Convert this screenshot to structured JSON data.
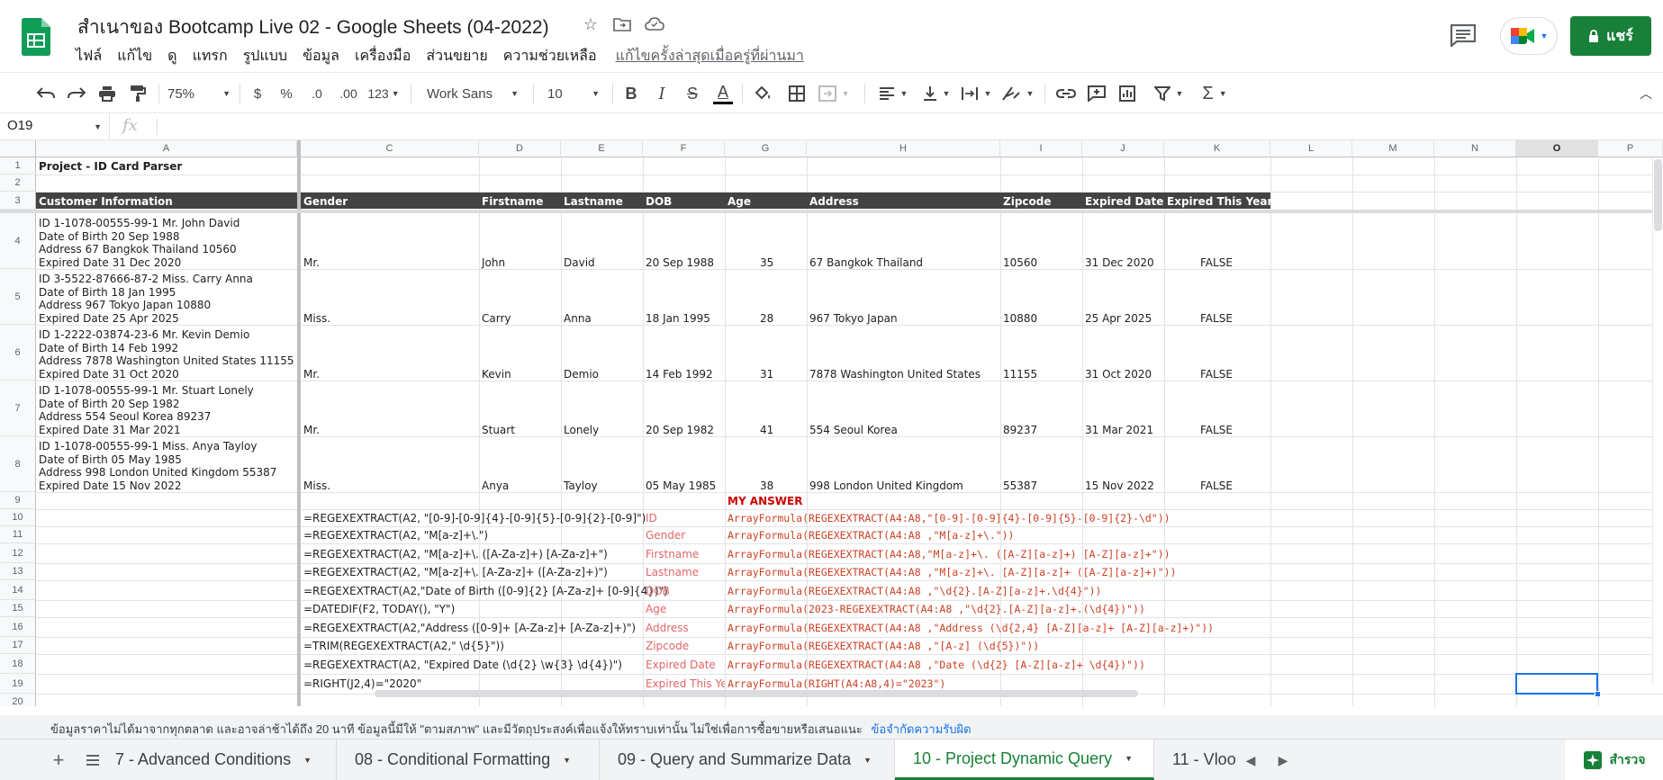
{
  "app": {
    "title": "สำเนาของ Bootcamp Live 02 - Google Sheets (04-2022)",
    "menu": [
      "ไฟล์",
      "แก้ไข",
      "ดู",
      "แทรก",
      "รูปแบบ",
      "ข้อมูล",
      "เครื่องมือ",
      "ส่วนขยาย",
      "ความช่วยเหลือ"
    ],
    "last_edit": "แก้ไขครั้งล่าสุดเมื่อครู่ที่ผ่านมา",
    "share_label": "แชร์",
    "colors": {
      "brand_green": "#188038",
      "header_band": "#434343",
      "formula_red": "#e06666",
      "selection_blue": "#1a73e8"
    }
  },
  "toolbar": {
    "zoom": "75%",
    "currency": "$",
    "percent": "%",
    "decrease_decimal": ".0",
    "increase_decimal": ".00",
    "more_formats": "123",
    "font": "Work Sans",
    "font_size": "10",
    "bold": "B",
    "italic": "I",
    "strikethrough": "S",
    "text_color": "A",
    "text_color_value": "#000000"
  },
  "formula_bar": {
    "cell_ref": "O19",
    "fx": "fx",
    "value": ""
  },
  "grid": {
    "columns": [
      "A",
      "C",
      "D",
      "E",
      "F",
      "G",
      "H",
      "I",
      "J",
      "K",
      "L",
      "M",
      "N",
      "O",
      "P"
    ],
    "selected_column": "O",
    "rows": [
      "1",
      "2",
      "3",
      "4",
      "5",
      "6",
      "7",
      "8",
      "9",
      "10",
      "11",
      "12",
      "13",
      "14",
      "15",
      "16",
      "17",
      "18",
      "19",
      "20"
    ],
    "selected_row": "19",
    "A1": "Project - ID Card Parser",
    "headers": {
      "A": "Customer Information",
      "C": "Gender",
      "D": "Firstname",
      "E": "Lastname",
      "F": "DOB",
      "G": "Age",
      "H": "Address",
      "I": "Zipcode",
      "J": "Expired Date",
      "K": "Expired This Year"
    },
    "records": [
      {
        "info": [
          "ID 1-1078-00555-99-1 Mr. John David",
          "Date of Birth 20 Sep 1988",
          "Address 67 Bangkok Thailand 10560",
          "Expired Date 31 Dec 2020"
        ],
        "gender": "Mr.",
        "first": "John",
        "last": "David",
        "dob": "20 Sep 1988",
        "age": "35",
        "address": "67 Bangkok Thailand",
        "zip": "10560",
        "exp": "31 Dec 2020",
        "exp_this_year": "FALSE"
      },
      {
        "info": [
          "ID 3-5522-87666-87-2 Miss. Carry Anna",
          "Date of Birth 18 Jan 1995",
          "Address 967 Tokyo Japan 10880",
          "Expired Date 25 Apr 2025"
        ],
        "gender": "Miss.",
        "first": "Carry",
        "last": "Anna",
        "dob": "18 Jan 1995",
        "age": "28",
        "address": "967 Tokyo Japan",
        "zip": "10880",
        "exp": "25 Apr 2025",
        "exp_this_year": "FALSE"
      },
      {
        "info": [
          "ID 1-2222-03874-23-6 Mr. Kevin Demio",
          "Date of Birth 14 Feb 1992",
          "Address 7878 Washington United States 11155",
          "Expired Date 31 Oct 2020"
        ],
        "gender": "Mr.",
        "first": "Kevin",
        "last": "Demio",
        "dob": "14 Feb 1992",
        "age": "31",
        "address": "7878 Washington United States",
        "zip": "11155",
        "exp": "31 Oct 2020",
        "exp_this_year": "FALSE"
      },
      {
        "info": [
          "ID 1-1078-00555-99-1 Mr. Stuart Lonely",
          "Date of Birth 20 Sep 1982",
          "Address 554 Seoul Korea 89237",
          "Expired Date 31 Mar 2021"
        ],
        "gender": "Mr.",
        "first": "Stuart",
        "last": "Lonely",
        "dob": "20 Sep 1982",
        "age": "41",
        "address": "554 Seoul Korea",
        "zip": "89237",
        "exp": "31 Mar 2021",
        "exp_this_year": "FALSE"
      },
      {
        "info": [
          "ID 1-1078-00555-99-1 Miss. Anya Tayloy",
          "Date of Birth 05 May 1985",
          "Address 998 London United Kingdom 55387",
          "Expired Date 15 Nov 2022"
        ],
        "gender": "Miss.",
        "first": "Anya",
        "last": "Tayloy",
        "dob": "05 May 1985",
        "age": "38",
        "address": "998 London United Kingdom",
        "zip": "55387",
        "exp": "15 Nov 2022",
        "exp_this_year": "FALSE"
      }
    ],
    "my_answer": "MY ANSWER",
    "formulas": [
      {
        "c": "=REGEXEXTRACT(A2, \"[0-9]-[0-9]{4}-[0-9]{5}-[0-9]{2}-[0-9]\")",
        "label": "ID",
        "answer": "ArrayFormula(REGEXEXTRACT(A4:A8,\"[0-9]-[0-9]{4}-[0-9]{5}-[0-9]{2}-\\d\"))"
      },
      {
        "c": "=REGEXEXTRACT(A2, \"M[a-z]+\\.\")",
        "label": "Gender",
        "answer": "ArrayFormula(REGEXEXTRACT(A4:A8 ,\"M[a-z]+\\.\"))"
      },
      {
        "c": "=REGEXEXTRACT(A2, \"M[a-z]+\\. ([A-Za-z]+) [A-Za-z]+\")",
        "label": "Firstname",
        "answer": "ArrayFormula(REGEXEXTRACT(A4:A8,\"M[a-z]+\\. ([A-Z][a-z]+) [A-Z][a-z]+\"))"
      },
      {
        "c": "=REGEXEXTRACT(A2, \"M[a-z]+\\. [A-Za-z]+ ([A-Za-z]+)\")",
        "label": "Lastname",
        "answer": "ArrayFormula(REGEXEXTRACT(A4:A8 ,\"M[a-z]+\\. [A-Z][a-z]+ ([A-Z][a-z]+)\"))"
      },
      {
        "c": "=REGEXEXTRACT(A2,\"Date of Birth ([0-9]{2} [A-Za-z]+ [0-9]{4})\")",
        "label": "DOB",
        "answer": "ArrayFormula(REGEXEXTRACT(A4:A8 ,\"\\d{2}.[A-Z][a-z]+.\\d{4}\"))"
      },
      {
        "c": "=DATEDIF(F2, TODAY(), \"Y\")",
        "label": "Age",
        "answer": "ArrayFormula(2023-REGEXEXTRACT(A4:A8 ,\"\\d{2}.[A-Z][a-z]+.(\\d{4})\"))"
      },
      {
        "c": "=REGEXEXTRACT(A2,\"Address ([0-9]+ [A-Za-z]+ [A-Za-z]+)\")",
        "label": "Address",
        "answer": "ArrayFormula(REGEXEXTRACT(A4:A8 ,\"Address (\\d{2,4} [A-Z][a-z]+ [A-Z][a-z]+)\"))"
      },
      {
        "c": "=TRIM(REGEXEXTRACT(A2,\" \\d{5}\"))",
        "label": "Zipcode",
        "answer": "ArrayFormula(REGEXEXTRACT(A4:A8 ,\"[A-z] (\\d{5})\"))"
      },
      {
        "c": "=REGEXEXTRACT(A2, \"Expired Date (\\d{2} \\w{3} \\d{4})\")",
        "label": "Expired Date",
        "answer": "ArrayFormula(REGEXEXTRACT(A4:A8 ,\"Date (\\d{2} [A-Z][a-z]+ \\d{4})\"))"
      },
      {
        "c": "=RIGHT(J2,4)=\"2020\"",
        "label": "Expired This Ye",
        "answer": "ArrayFormula(RIGHT(A4:A8,4)=\"2023\")"
      }
    ]
  },
  "disclaimer": {
    "text": "ข้อมูลราคาไม่ได้มาจากทุกตลาด และอาจล่าช้าได้ถึง 20 นาที ข้อมูลนี้มีให้ \"ตามสภาพ\" และมีวัตถุประสงค์เพื่อแจ้งให้ทราบเท่านั้น ไม่ใช่เพื่อการซื้อขายหรือเสนอแนะ",
    "link": "ข้อจำกัดความรับผิด"
  },
  "tabs": [
    {
      "label": "7 - Advanced Conditions",
      "active": false
    },
    {
      "label": "08 - Conditional Formatting",
      "active": false
    },
    {
      "label": "09 - Query and Summarize Data",
      "active": false
    },
    {
      "label": "10 - Project Dynamic Query",
      "active": true
    },
    {
      "label": "11 - Vloo",
      "active": false
    }
  ],
  "explore_label": "สำรวจ"
}
